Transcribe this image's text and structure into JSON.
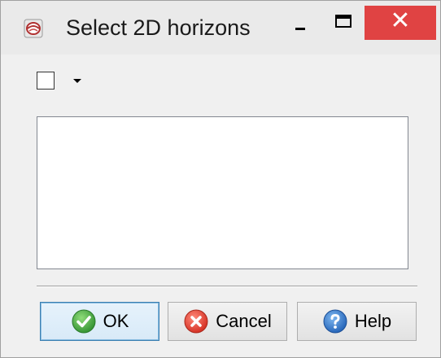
{
  "window": {
    "title": "Select 2D horizons",
    "controls": {
      "minimize_icon": "minimize-icon",
      "maximize_icon": "maximize-icon",
      "close_glyph": "✕"
    },
    "close_color": "#e04343"
  },
  "toolbar": {
    "select_all_checked": false,
    "dropdown_icon": "triangle-down-icon"
  },
  "list": {
    "items": []
  },
  "buttons": {
    "ok_label": "OK",
    "cancel_label": "Cancel",
    "help_label": "Help"
  },
  "icons": {
    "ok": "checkmark-icon",
    "cancel": "close-circle-icon",
    "help": "question-icon"
  }
}
